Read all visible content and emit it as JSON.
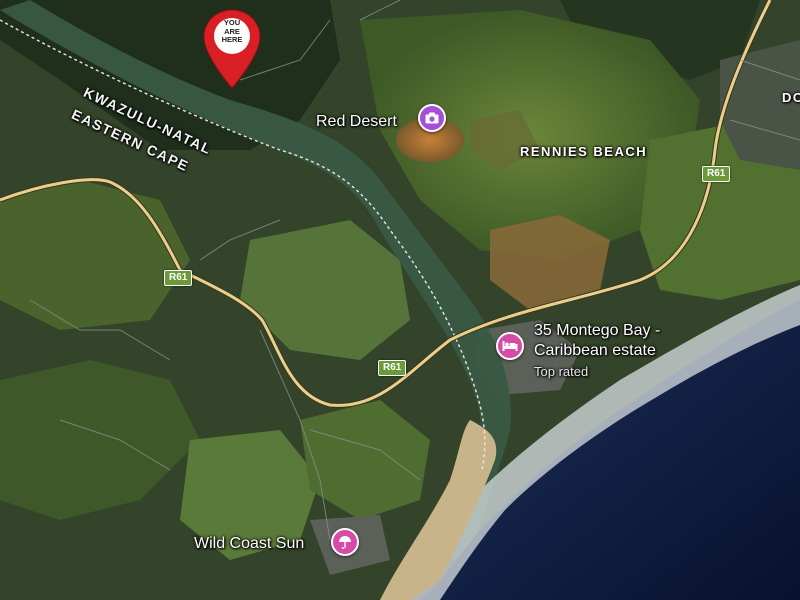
{
  "map": {
    "area_label": "RENNIES BEACH",
    "edge_label": "DO",
    "province_north": "KWAZULU-NATAL",
    "province_south": "EASTERN CAPE",
    "road_shields": [
      "R61",
      "R61",
      "R61"
    ],
    "you_are_here": "YOU ARE HERE",
    "pois": [
      {
        "name": "Red Desert",
        "icon": "camera-icon",
        "color": "#a54fd8"
      },
      {
        "name": "35 Montego Bay -",
        "name_line2": "Caribbean estate",
        "subtitle": "Top rated",
        "icon": "bed-icon",
        "color": "#d74aa6"
      },
      {
        "name": "Wild Coast Sun",
        "icon": "umbrella-icon",
        "color": "#d74aa6"
      }
    ],
    "colors": {
      "road": "#e8d08a",
      "shield": "#6a9a3a",
      "pin": "#d81f26",
      "ocean": "#0d1a3d"
    }
  }
}
